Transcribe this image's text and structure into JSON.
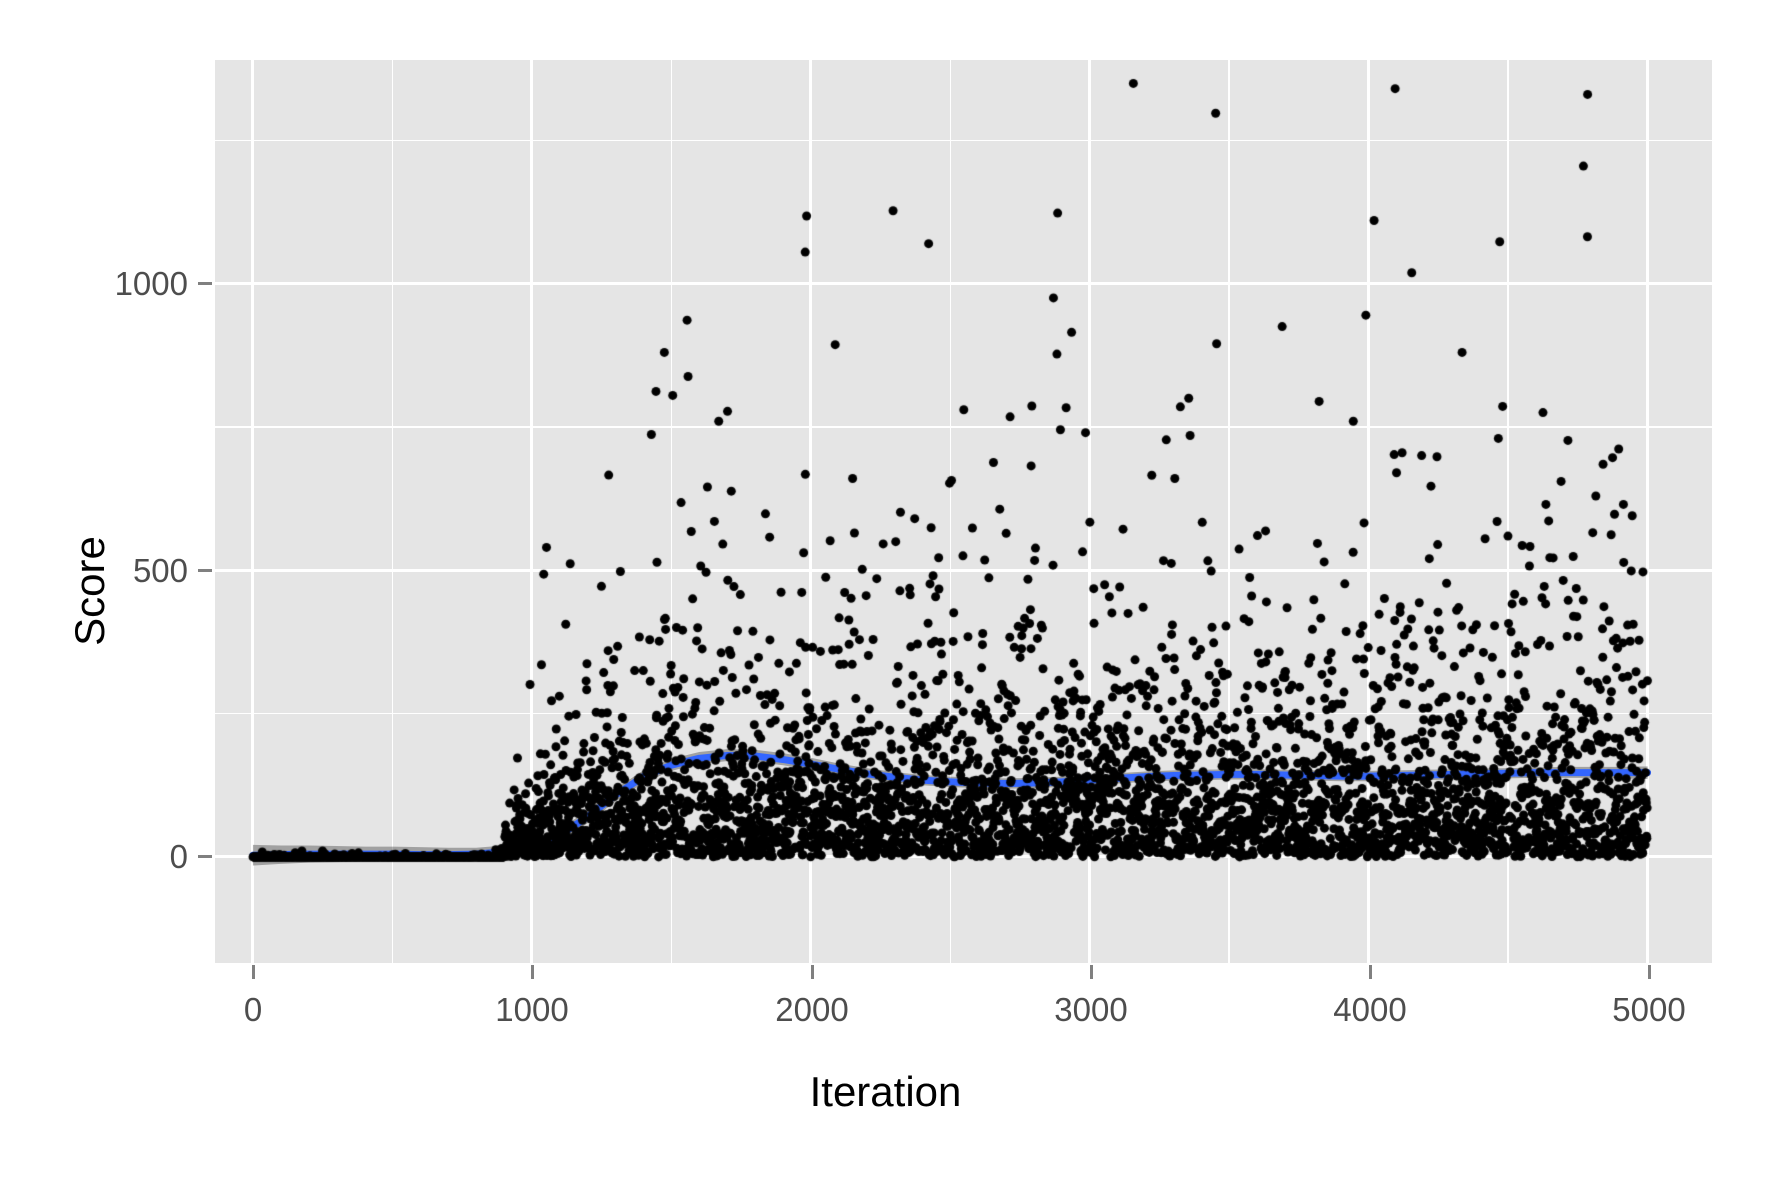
{
  "chart_data": {
    "type": "scatter",
    "title": "",
    "subtitle": "",
    "xlabel": "Iteration",
    "ylabel": "Score",
    "xlim": [
      -136,
      5231
    ],
    "ylim": [
      -185,
      1390
    ],
    "xticks": [
      0,
      1000,
      2000,
      3000,
      4000,
      5000
    ],
    "xtick_labels": [
      "0",
      "1000",
      "2000",
      "3000",
      "4000",
      "5000"
    ],
    "yticks": [
      0,
      500,
      1000
    ],
    "ytick_labels": [
      "0",
      "500",
      "1000"
    ],
    "x_minor_ticks": [
      500,
      1500,
      2500,
      3500,
      4500
    ],
    "y_minor_ticks": [
      250,
      750,
      1250
    ],
    "grid": true,
    "legend": "none",
    "point_color": "#000000",
    "point_size": 9,
    "panel_background": "#e5e5e5",
    "grid_color": "#ffffff",
    "axis_text_color": "#4d4d4d",
    "axis_title_color": "#000000",
    "n_points": 5000,
    "description": "Scatter of reinforcement-learning Score versus training Iteration with a blue loess smoother and grey confidence ribbon. Scores stay near 0 until ~iteration 1000, then rise and fan out, with the bulk of points between 0 and 300 and occasional outliers above 1000.",
    "smooth": {
      "type": "loess",
      "line_color": "#3366ff",
      "line_width": 7,
      "ribbon_color": "#4d4d4d",
      "ribbon_opacity": 0.45,
      "x": [
        0,
        100,
        200,
        300,
        400,
        500,
        600,
        700,
        800,
        900,
        1000,
        1100,
        1200,
        1300,
        1400,
        1500,
        1600,
        1700,
        1800,
        1900,
        2000,
        2100,
        2200,
        2300,
        2400,
        2500,
        2600,
        2700,
        2800,
        2900,
        3000,
        3100,
        3200,
        3300,
        3400,
        3500,
        3600,
        3700,
        3800,
        3900,
        4000,
        4100,
        4200,
        4300,
        4400,
        4500,
        4600,
        4700,
        4800,
        4900,
        5000
      ],
      "y": [
        3,
        4,
        5,
        5,
        5,
        5,
        4,
        4,
        5,
        9,
        18,
        38,
        70,
        108,
        140,
        160,
        172,
        177,
        176,
        170,
        162,
        153,
        145,
        139,
        134,
        131,
        129,
        128,
        129,
        131,
        134,
        137,
        140,
        142,
        143,
        144,
        144,
        143,
        142,
        141,
        141,
        142,
        143,
        144,
        145,
        146,
        147,
        147,
        147,
        147,
        147
      ],
      "ymin": [
        -15,
        -12,
        -10,
        -9,
        -8,
        -8,
        -8,
        -8,
        -6,
        -2,
        7,
        27,
        59,
        97,
        129,
        150,
        162,
        167,
        166,
        160,
        152,
        144,
        136,
        130,
        125,
        122,
        120,
        119,
        120,
        122,
        125,
        128,
        131,
        133,
        134,
        135,
        135,
        134,
        133,
        132,
        132,
        133,
        134,
        135,
        136,
        137,
        138,
        138,
        138,
        137,
        136
      ],
      "ymax": [
        21,
        20,
        20,
        19,
        18,
        18,
        17,
        16,
        16,
        20,
        29,
        49,
        81,
        119,
        151,
        171,
        183,
        188,
        187,
        181,
        173,
        163,
        155,
        148,
        143,
        140,
        138,
        137,
        138,
        140,
        143,
        146,
        149,
        151,
        152,
        153,
        153,
        152,
        151,
        150,
        150,
        151,
        152,
        153,
        154,
        155,
        156,
        157,
        157,
        157,
        158
      ]
    },
    "outliers": [
      {
        "x": 1985,
        "y": 1118
      },
      {
        "x": 1980,
        "y": 1055
      },
      {
        "x": 2295,
        "y": 1127
      },
      {
        "x": 2885,
        "y": 1123
      },
      {
        "x": 2870,
        "y": 975
      },
      {
        "x": 4095,
        "y": 1340
      },
      {
        "x": 4785,
        "y": 1330
      },
      {
        "x": 4770,
        "y": 1205
      },
      {
        "x": 4470,
        "y": 1073
      },
      {
        "x": 3990,
        "y": 945
      },
      {
        "x": 3690,
        "y": 925
      },
      {
        "x": 2935,
        "y": 915
      },
      {
        "x": 3455,
        "y": 895
      },
      {
        "x": 4335,
        "y": 880
      },
      {
        "x": 1475,
        "y": 880
      },
      {
        "x": 1560,
        "y": 838
      },
      {
        "x": 1445,
        "y": 812
      },
      {
        "x": 1505,
        "y": 805
      },
      {
        "x": 3355,
        "y": 800
      },
      {
        "x": 3325,
        "y": 785
      },
      {
        "x": 4625,
        "y": 775
      },
      {
        "x": 1670,
        "y": 760
      },
      {
        "x": 3945,
        "y": 760
      },
      {
        "x": 2895,
        "y": 745
      },
      {
        "x": 2985,
        "y": 740
      },
      {
        "x": 3360,
        "y": 735
      },
      {
        "x": 4465,
        "y": 730
      },
      {
        "x": 4120,
        "y": 705
      },
      {
        "x": 4190,
        "y": 700
      },
      {
        "x": 4245,
        "y": 698
      },
      {
        "x": 2655,
        "y": 688
      },
      {
        "x": 2790,
        "y": 682
      },
      {
        "x": 2150,
        "y": 660
      },
      {
        "x": 1715,
        "y": 638
      },
      {
        "x": 1535,
        "y": 618
      },
      {
        "x": 4100,
        "y": 670
      },
      {
        "x": 3305,
        "y": 660
      },
      {
        "x": 4690,
        "y": 655
      },
      {
        "x": 4945,
        "y": 595
      }
    ]
  },
  "axes": {
    "y_title": "Score",
    "x_title": "Iteration",
    "y_tick_0": "0",
    "y_tick_500": "500",
    "y_tick_1000": "1000",
    "x_tick_0": "0",
    "x_tick_1000": "1000",
    "x_tick_2000": "2000",
    "x_tick_3000": "3000",
    "x_tick_4000": "4000",
    "x_tick_5000": "5000"
  }
}
